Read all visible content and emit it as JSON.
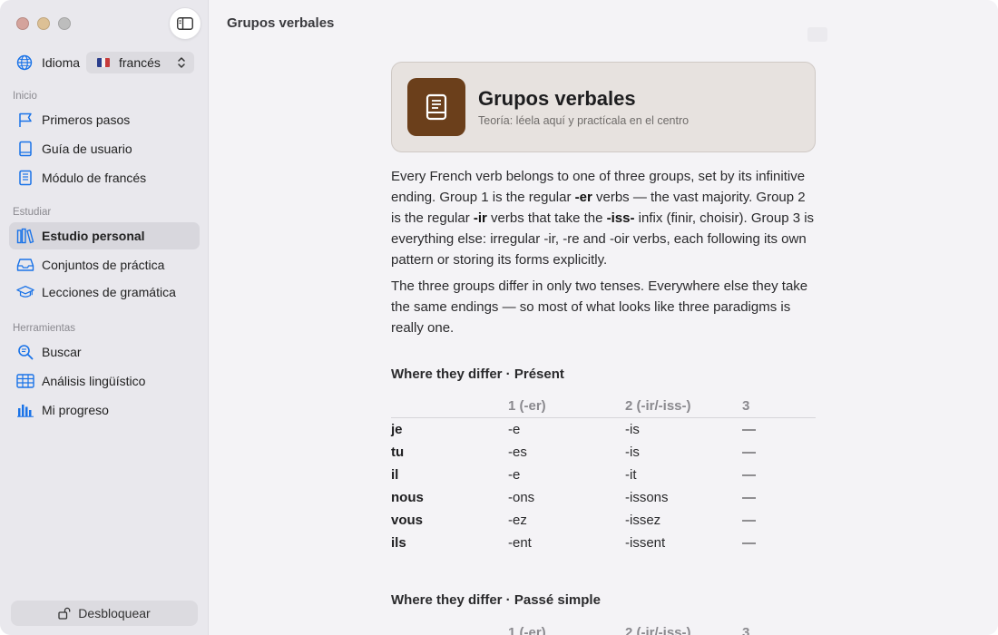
{
  "sidebar": {
    "language_label": "Idioma",
    "language_value": "francés",
    "sections": [
      {
        "title": "Inicio",
        "items": [
          {
            "label": "Primeros pasos",
            "icon": "flag-icon"
          },
          {
            "label": "Guía de usuario",
            "icon": "book-icon"
          },
          {
            "label": "Módulo de francés",
            "icon": "book-page-icon"
          }
        ]
      },
      {
        "title": "Estudiar",
        "items": [
          {
            "label": "Estudio personal",
            "icon": "books-icon",
            "active": true
          },
          {
            "label": "Conjuntos de práctica",
            "icon": "tray-icon"
          },
          {
            "label": "Lecciones de gramática",
            "icon": "graduation-cap-icon"
          }
        ]
      },
      {
        "title": "Herramientas",
        "items": [
          {
            "label": "Buscar",
            "icon": "search-icon"
          },
          {
            "label": "Análisis lingüístico",
            "icon": "table-icon"
          },
          {
            "label": "Mi progreso",
            "icon": "bar-chart-icon"
          }
        ]
      }
    ],
    "unlock_label": "Desbloquear"
  },
  "main": {
    "title": "Grupos verbales",
    "hero": {
      "title": "Grupos verbales",
      "subtitle": "Teoría: léela aquí y practícala en el centro"
    },
    "para1": {
      "t1": "Every French verb belongs to one of three groups, set by its infinitive ending. Group 1 is the regular ",
      "b1": "-er",
      "t2": " verbs — the vast majority. Group 2 is the regular ",
      "b2": "-ir",
      "t3": " verbs that take the ",
      "b3": "-iss-",
      "t4": " infix (finir, choisir). Group 3 is everything else: irregular -ir, -re and -oir verbs, each following its own pattern or storing its forms explicitly."
    },
    "para2": "The three groups differ in only two tenses. Everywhere else they take the same endings — so most of what looks like three paradigms is really one.",
    "table1": {
      "title": "Where they differ · Présent",
      "headers": [
        "",
        "1 (-er)",
        "2 (-ir/-iss-)",
        "3"
      ],
      "rows": [
        [
          "je",
          "-e",
          "-is",
          "—"
        ],
        [
          "tu",
          "-es",
          "-is",
          "—"
        ],
        [
          "il",
          "-e",
          "-it",
          "—"
        ],
        [
          "nous",
          "-ons",
          "-issons",
          "—"
        ],
        [
          "vous",
          "-ez",
          "-issez",
          "—"
        ],
        [
          "ils",
          "-ent",
          "-issent",
          "—"
        ]
      ]
    },
    "table2": {
      "title": "Where they differ · Passé simple",
      "headers": [
        "",
        "1 (-er)",
        "2 (-ir/-iss-)",
        "3"
      ]
    }
  },
  "colors": {
    "accent": "#1a73e8",
    "hero_icon_bg": "#6b3f1b",
    "hero_bg": "#e7e2df"
  }
}
